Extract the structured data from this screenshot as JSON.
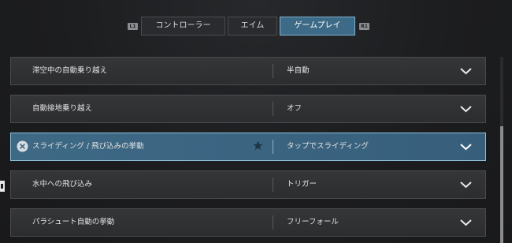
{
  "tabs": {
    "left_bumper": "L1",
    "right_bumper": "R1",
    "items": [
      {
        "label": "コントローラー"
      },
      {
        "label": "エイム"
      },
      {
        "label": "ゲームプレイ",
        "selected": true
      }
    ]
  },
  "settings": [
    {
      "label": "滞空中の自動乗り越え",
      "value": "半自動"
    },
    {
      "label": "自動接地乗り越え",
      "value": "オフ"
    },
    {
      "label": "スライディング / 飛び込みの挙動",
      "value": "タップでスライディング",
      "active": true
    },
    {
      "label": "水中への飛び込み",
      "value": "トリガー"
    },
    {
      "label": "パラシュート自動の挙動",
      "value": "フリーフォール"
    }
  ],
  "icons": {
    "dropdown": "chevron-down-icon",
    "clear": "close-circle-icon",
    "favorite": "star-icon"
  },
  "colors": {
    "selected_tab": "#3d6a86",
    "active_row": "#3e6985",
    "active_border": "#8dc0dc"
  }
}
